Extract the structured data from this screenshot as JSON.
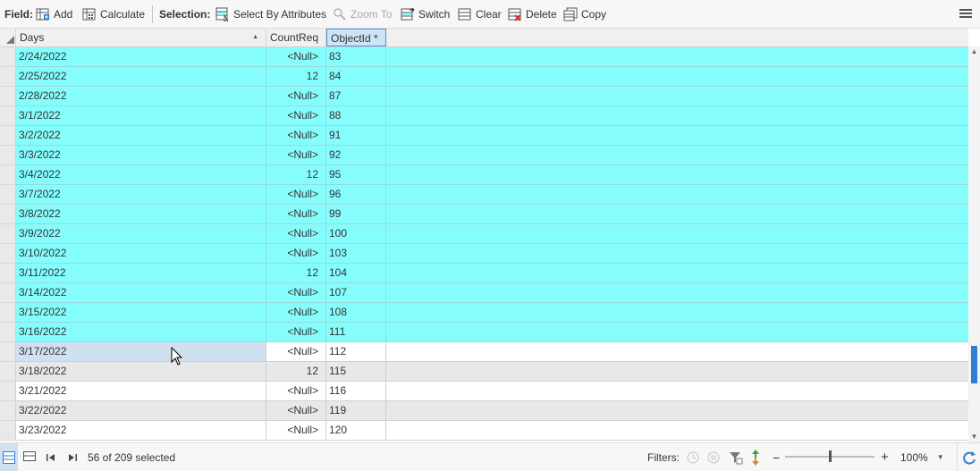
{
  "toolbar": {
    "field_label": "Field:",
    "add_label": "Add",
    "calculate_label": "Calculate",
    "selection_label": "Selection:",
    "select_by_attributes_label": "Select By Attributes",
    "zoom_to_label": "Zoom To",
    "switch_label": "Switch",
    "clear_label": "Clear",
    "delete_label": "Delete",
    "copy_label": "Copy"
  },
  "columns": {
    "days": "Days",
    "countreq": "CountReq",
    "objectid": "ObjectId *",
    "sort_indicator": "▲"
  },
  "rows": [
    {
      "days": "2/24/2022",
      "countreq": "<Null>",
      "objectid": "83",
      "state": "selected"
    },
    {
      "days": "2/25/2022",
      "countreq": "12",
      "objectid": "84",
      "state": "selected"
    },
    {
      "days": "2/28/2022",
      "countreq": "<Null>",
      "objectid": "87",
      "state": "selected"
    },
    {
      "days": "3/1/2022",
      "countreq": "<Null>",
      "objectid": "88",
      "state": "selected"
    },
    {
      "days": "3/2/2022",
      "countreq": "<Null>",
      "objectid": "91",
      "state": "selected"
    },
    {
      "days": "3/3/2022",
      "countreq": "<Null>",
      "objectid": "92",
      "state": "selected"
    },
    {
      "days": "3/4/2022",
      "countreq": "12",
      "objectid": "95",
      "state": "selected"
    },
    {
      "days": "3/7/2022",
      "countreq": "<Null>",
      "objectid": "96",
      "state": "selected"
    },
    {
      "days": "3/8/2022",
      "countreq": "<Null>",
      "objectid": "99",
      "state": "selected"
    },
    {
      "days": "3/9/2022",
      "countreq": "<Null>",
      "objectid": "100",
      "state": "selected"
    },
    {
      "days": "3/10/2022",
      "countreq": "<Null>",
      "objectid": "103",
      "state": "selected"
    },
    {
      "days": "3/11/2022",
      "countreq": "12",
      "objectid": "104",
      "state": "selected"
    },
    {
      "days": "3/14/2022",
      "countreq": "<Null>",
      "objectid": "107",
      "state": "selected"
    },
    {
      "days": "3/15/2022",
      "countreq": "<Null>",
      "objectid": "108",
      "state": "selected"
    },
    {
      "days": "3/16/2022",
      "countreq": "<Null>",
      "objectid": "111",
      "state": "selected"
    },
    {
      "days": "3/17/2022",
      "countreq": "<Null>",
      "objectid": "112",
      "state": "current"
    },
    {
      "days": "3/18/2022",
      "countreq": "12",
      "objectid": "115",
      "state": "alt"
    },
    {
      "days": "3/21/2022",
      "countreq": "<Null>",
      "objectid": "116",
      "state": "normal"
    },
    {
      "days": "3/22/2022",
      "countreq": "<Null>",
      "objectid": "119",
      "state": "alt"
    },
    {
      "days": "3/23/2022",
      "countreq": "<Null>",
      "objectid": "120",
      "state": "normal"
    }
  ],
  "status": {
    "selection_text": "56 of 209 selected",
    "filters_label": "Filters:",
    "zoom_value": "100%",
    "zoom_minus": "−",
    "zoom_plus": "+"
  },
  "colors": {
    "selected_row": "#86fdfd",
    "accent": "#2d7fd3"
  },
  "icons": [
    "field-add-icon",
    "calculate-icon",
    "select-by-attributes-icon",
    "zoom-to-icon",
    "switch-selection-icon",
    "clear-selection-icon",
    "delete-icon",
    "copy-icon",
    "menu-icon",
    "table-view-icon",
    "list-view-icon",
    "first-record-icon",
    "last-record-icon",
    "filter-time-icon",
    "filter-range-icon",
    "filter-definition-icon",
    "filter-switch-icon",
    "refresh-icon",
    "mouse-cursor-icon"
  ]
}
